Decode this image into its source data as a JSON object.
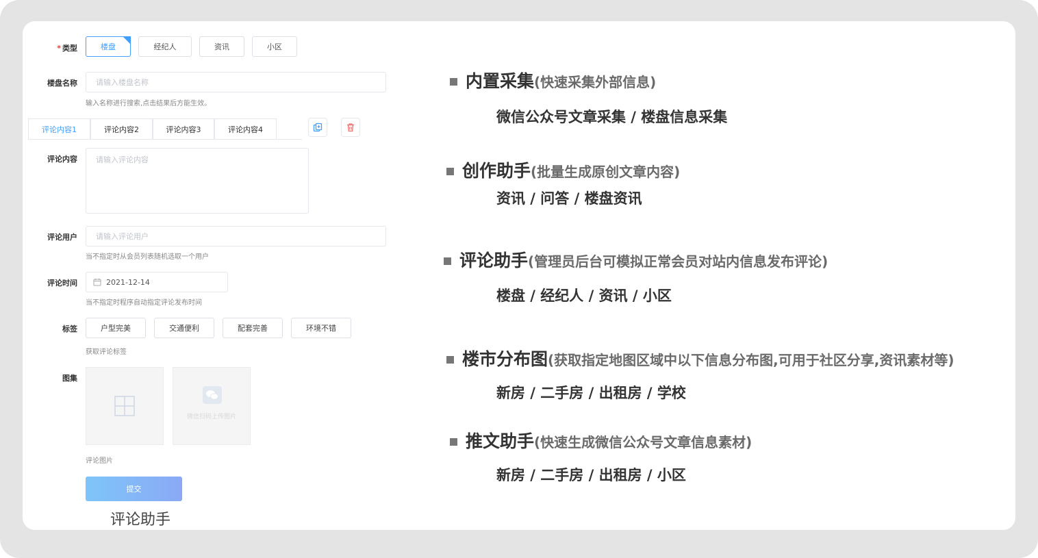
{
  "form": {
    "type": {
      "label": "类型",
      "required_mark": "*",
      "options": [
        "楼盘",
        "经纪人",
        "资讯",
        "小区"
      ],
      "selected": "楼盘"
    },
    "estate_name": {
      "label": "楼盘名称",
      "placeholder": "请输入楼盘名称",
      "hint": "输入名称进行搜索,点击结果后方能生效。"
    },
    "comment_tabs": [
      "评论内容1",
      "评论内容2",
      "评论内容3",
      "评论内容4"
    ],
    "comment_content": {
      "label": "评论内容",
      "placeholder": "请输入评论内容"
    },
    "comment_user": {
      "label": "评论用户",
      "placeholder": "请输入评论用户",
      "hint": "当不指定时从会员列表随机选取一个用户"
    },
    "comment_time": {
      "label": "评论时间",
      "value": "2021-12-14",
      "hint": "当不指定时程序自动指定评论发布时间"
    },
    "tags": {
      "label": "标签",
      "items": [
        "户型完美",
        "交通便利",
        "配套完善",
        "环境不错"
      ],
      "hint": "获取评论标签"
    },
    "gallery": {
      "label": "图集",
      "wechat_upload": "微信扫码上传图片",
      "hint": "评论图片"
    },
    "submit_label": "提交",
    "caption": "评论助手"
  },
  "features": [
    {
      "name": "内置采集",
      "desc": "(快速采集外部信息)",
      "items": "微信公众号文章采集 / 楼盘信息采集"
    },
    {
      "name": "创作助手",
      "desc": "(批量生成原创文章内容)",
      "items": "资讯 / 问答 / 楼盘资讯"
    },
    {
      "name": "评论助手",
      "desc": "(管理员后台可模拟正常会员对站内信息发布评论)",
      "items": "楼盘  / 经纪人 / 资讯 / 小区"
    },
    {
      "name": "楼市分布图",
      "desc": "(获取指定地图区域中以下信息分布图,可用于社区分享,资讯素材等)",
      "items": "新房  / 二手房 / 出租房 / 学校"
    },
    {
      "name": "推文助手",
      "desc": "(快速生成微信公众号文章信息素材)",
      "items": "新房  / 二手房 / 出租房 / 小区"
    }
  ],
  "colors": {
    "accent": "#409eff",
    "danger": "#f56c6c",
    "submit_gradient_start": "#7ec5f9",
    "submit_gradient_end": "#8aa9f5"
  }
}
